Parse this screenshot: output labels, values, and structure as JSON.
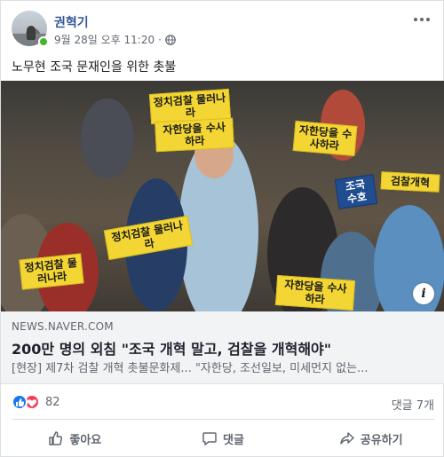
{
  "post": {
    "author": "권혁기",
    "timestamp": "9월 28일 오후 11:20",
    "separator": "·",
    "privacy_icon": "globe-icon",
    "text": "노무현 조국 문재인을 위한 촛불"
  },
  "photo": {
    "signs": [
      "정치검찰 물러나라",
      "자한당을 수사하라",
      "정치검찰 물러나라",
      "자한당을 수사하라",
      "조국 수호",
      "검찰개혁"
    ],
    "info_label": "i"
  },
  "link": {
    "source": "NEWS.NAVER.COM",
    "title": "200만 명의 외침 \"조국 개혁 말고, 검찰을 개혁해야\"",
    "description": "[현장] 제7차 검찰 개혁 촛불문화제... \"자한당, 조선일보, 미세먼지 없는..."
  },
  "stats": {
    "reaction_count": "82",
    "comment_count": "댓글 7개"
  },
  "actions": {
    "like": "좋아요",
    "comment": "댓글",
    "share": "공유하기"
  },
  "colors": {
    "author_link": "#365899",
    "like_blue": "#1877f2",
    "love_red": "#f33e58",
    "sign_yellow": "#f3d634",
    "online_green": "#42b72a"
  }
}
